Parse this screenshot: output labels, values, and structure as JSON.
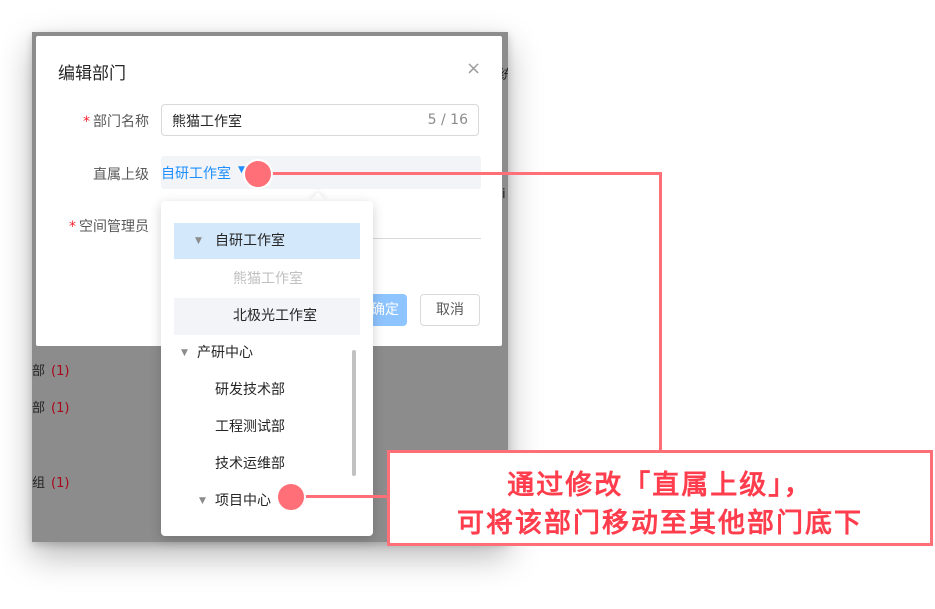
{
  "background": {
    "list_items": [
      {
        "label": "部",
        "count": "(1)"
      },
      {
        "label": "部",
        "count": "(1)"
      },
      {
        "label": "组",
        "count": "(1)"
      }
    ],
    "cut_chars": [
      "统",
      "i"
    ]
  },
  "modal": {
    "title": "编辑部门",
    "close_symbol": "×",
    "dept_name": {
      "label": "部门名称",
      "required_mark": "*",
      "value": "熊猫工作室",
      "counter": "5 / 16"
    },
    "parent": {
      "label": "直属上级",
      "value": "自研工作室",
      "caret": "▼"
    },
    "admin": {
      "label": "空间管理员",
      "required_mark": "*"
    },
    "ok_button": "确定",
    "cancel_button": "取消"
  },
  "dropdown": {
    "caret": "▼",
    "items": [
      {
        "label": "自研工作室",
        "expanded": true,
        "state": "selected"
      },
      {
        "label": "熊猫工作室",
        "state": "disabled"
      },
      {
        "label": "北极光工作室",
        "state": "hover"
      },
      {
        "label": "产研中心",
        "expanded": true,
        "state": "normal"
      },
      {
        "label": "研发技术部",
        "state": "normal"
      },
      {
        "label": "工程测试部",
        "state": "normal"
      },
      {
        "label": "技术运维部",
        "state": "normal"
      },
      {
        "label": "项目中心",
        "expanded": true,
        "state": "normal"
      }
    ]
  },
  "annotation": {
    "line1": "通过修改「直属上级」，",
    "line2": "可将该部门移动至其他部门底下",
    "color": "#ff6f78",
    "text_color": "#ff3d4d"
  },
  "colors": {
    "accent": "#1f8fff",
    "danger": "#f5222d"
  }
}
